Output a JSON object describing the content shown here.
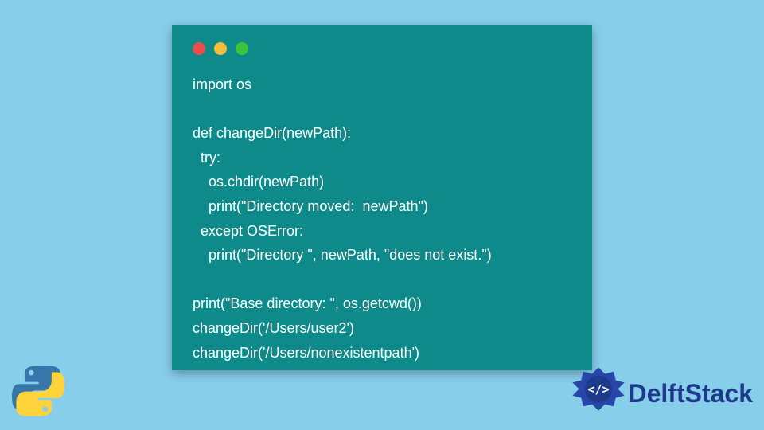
{
  "code": {
    "lines": [
      "import os",
      "",
      "def changeDir(newPath):",
      "  try:",
      "    os.chdir(newPath)",
      "    print(\"Directory moved:  newPath\")",
      "  except OSError:",
      "    print(\"Directory \", newPath, \"does not exist.\")",
      "",
      "print(\"Base directory: \", os.getcwd())",
      "changeDir('/Users/user2')",
      "changeDir('/Users/nonexistentpath')"
    ]
  },
  "brand": {
    "name": "DelftStack"
  }
}
